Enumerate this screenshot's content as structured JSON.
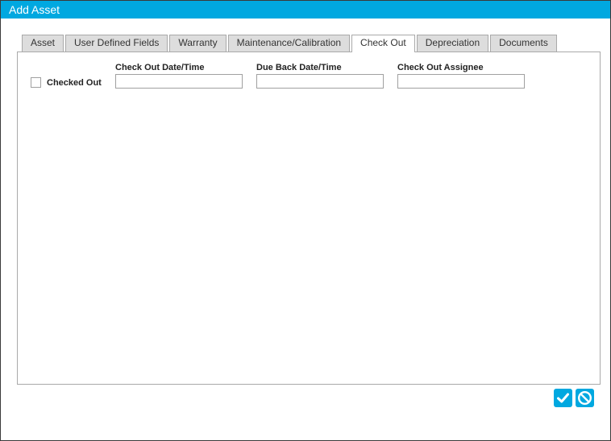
{
  "window": {
    "title": "Add Asset"
  },
  "tabs": [
    {
      "label": "Asset",
      "active": false
    },
    {
      "label": "User Defined Fields",
      "active": false
    },
    {
      "label": "Warranty",
      "active": false
    },
    {
      "label": "Maintenance/Calibration",
      "active": false
    },
    {
      "label": "Check Out",
      "active": true
    },
    {
      "label": "Depreciation",
      "active": false
    },
    {
      "label": "Documents",
      "active": false
    }
  ],
  "checkout": {
    "checked_out_label": "Checked Out",
    "checked_out_value": false,
    "checkout_datetime_label": "Check Out Date/Time",
    "checkout_datetime_value": "",
    "due_back_label": "Due Back Date/Time",
    "due_back_value": "",
    "assignee_label": "Check Out Assignee",
    "assignee_value": ""
  },
  "actions": {
    "confirm_icon": "checkmark-icon",
    "cancel_icon": "cancel-icon"
  },
  "colors": {
    "accent": "#00a8e0",
    "tab_inactive": "#dddddd",
    "border": "#a9a9a9"
  }
}
